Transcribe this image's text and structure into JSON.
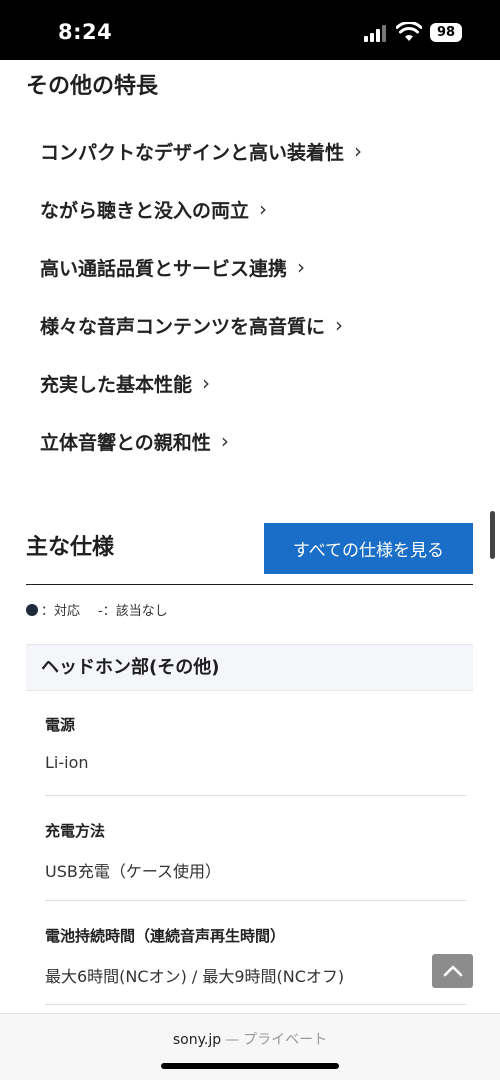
{
  "status_bar": {
    "time": "8:24",
    "battery": "98"
  },
  "other_features": {
    "title": "その他の特長",
    "items": [
      "コンパクトなデザインと高い装着性",
      "ながら聴きと没入の両立",
      "高い通話品質とサービス連携",
      "様々な音声コンテンツを高音質に",
      "充実した基本性能",
      "立体音響との親和性"
    ],
    "chevron": "›"
  },
  "specs": {
    "title": "主な仕様",
    "view_all_label": "すべての仕様を見る",
    "legend_supported": "：対応",
    "legend_na": "-：該当なし",
    "group_title": "ヘッドホン部(その他)",
    "items": [
      {
        "label": "電源",
        "value": "Li-ion"
      },
      {
        "label": "充電方法",
        "value": "USB充電（ケース使用）"
      },
      {
        "label": "電池持続時間（連続音声再生時間）",
        "value": "最大6時間(NCオン) / 最大9時間(NCオフ)"
      }
    ]
  },
  "url_bar": {
    "domain": "sony.jp",
    "separator": "—",
    "mode": "プライベート"
  }
}
